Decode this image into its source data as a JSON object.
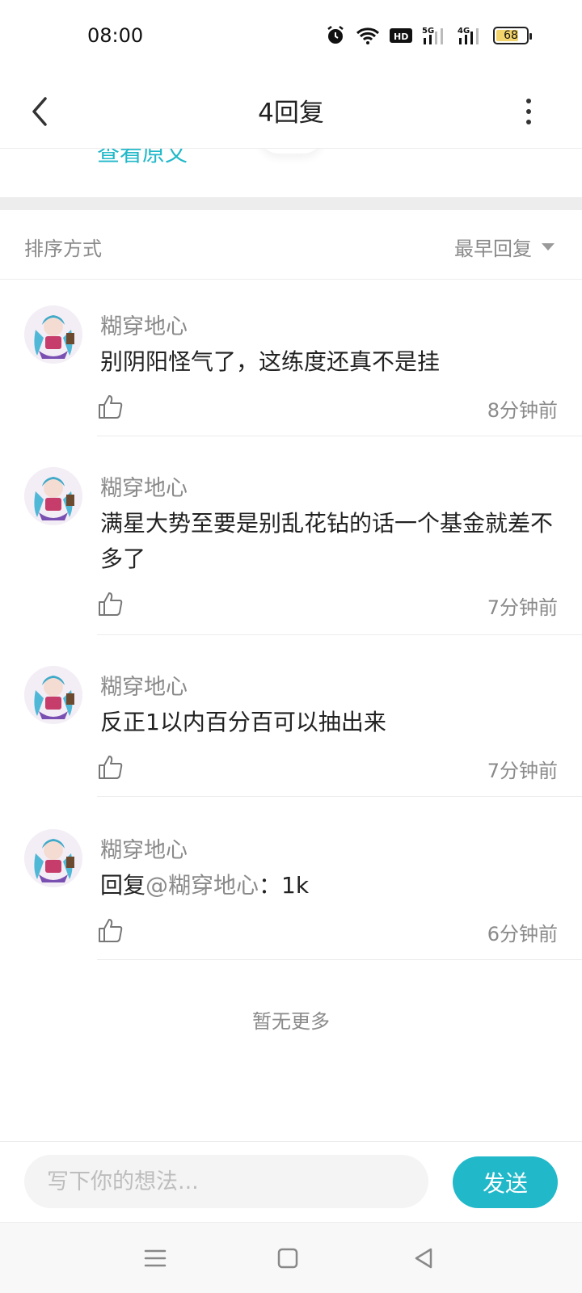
{
  "status_bar": {
    "time": "08:00",
    "battery_level": "68",
    "icons": [
      "alarm-icon",
      "wifi-icon",
      "hd-icon",
      "signal-5g-icon",
      "signal-4g-icon",
      "battery-icon"
    ],
    "hd_label": "HD",
    "net1_label": "5G",
    "net2_label": "4G"
  },
  "header": {
    "title": "4回复",
    "back_icon": "back-arrow-icon",
    "more_icon": "more-vertical-icon"
  },
  "original_link": "查看原文",
  "sort": {
    "label": "排序方式",
    "selected": "最早回复"
  },
  "replies": [
    {
      "user": "糊穿地心",
      "content": "别阴阳怪气了，这练度还真不是挂",
      "time": "8分钟前"
    },
    {
      "user": "糊穿地心",
      "content": "满星大势至要是别乱花钻的话一个基金就差不多了",
      "time": "7分钟前"
    },
    {
      "user": "糊穿地心",
      "content": "反正1以内百分百可以抽出来",
      "time": "7分钟前"
    },
    {
      "user": "糊穿地心",
      "content_prefix": "回复",
      "mention": "@糊穿地心",
      "content_suffix": "：1k",
      "time": "6分钟前"
    }
  ],
  "no_more": "暂无更多",
  "input": {
    "placeholder": "写下你的想法...",
    "send_label": "发送"
  },
  "colors": {
    "accent": "#21b8c9",
    "muted_text": "#8a8a8a",
    "body_text": "#222222",
    "separator": "#ededed"
  }
}
